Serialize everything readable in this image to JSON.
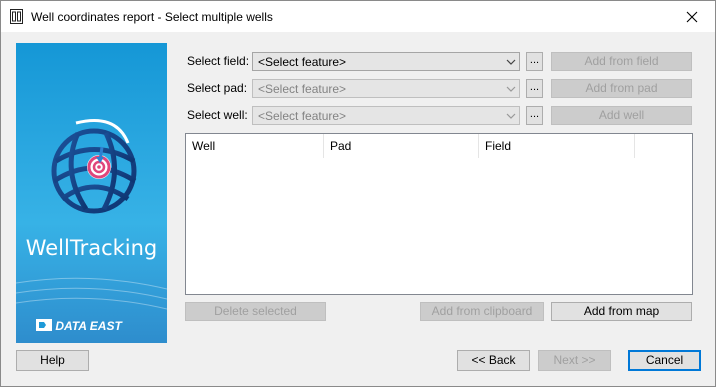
{
  "window": {
    "title": "Well coordinates report - Select multiple wells"
  },
  "banner": {
    "product_name": "WellTracking",
    "company_logo_text": "DATA EAST"
  },
  "form": {
    "field": {
      "label": "Select field:",
      "value": "<Select feature>",
      "browse_label": "...",
      "add_label": "Add from field"
    },
    "pad": {
      "label": "Select pad:",
      "value": "<Select feature>",
      "browse_label": "...",
      "add_label": "Add from pad"
    },
    "well": {
      "label": "Select well:",
      "value": "<Select feature>",
      "browse_label": "...",
      "add_label": "Add well"
    }
  },
  "wells_list": {
    "columns": [
      "Well",
      "Pad",
      "Field"
    ],
    "rows": []
  },
  "list_actions": {
    "delete_selected": "Delete selected",
    "add_from_clipboard": "Add from clipboard",
    "add_from_map": "Add from map"
  },
  "footer": {
    "help": "Help",
    "back": "<< Back",
    "next": "Next >>",
    "cancel": "Cancel"
  },
  "colors": {
    "banner_blue": "#1e9ad8",
    "focus_blue": "#0078d7",
    "target_pink": "#e0457b"
  }
}
